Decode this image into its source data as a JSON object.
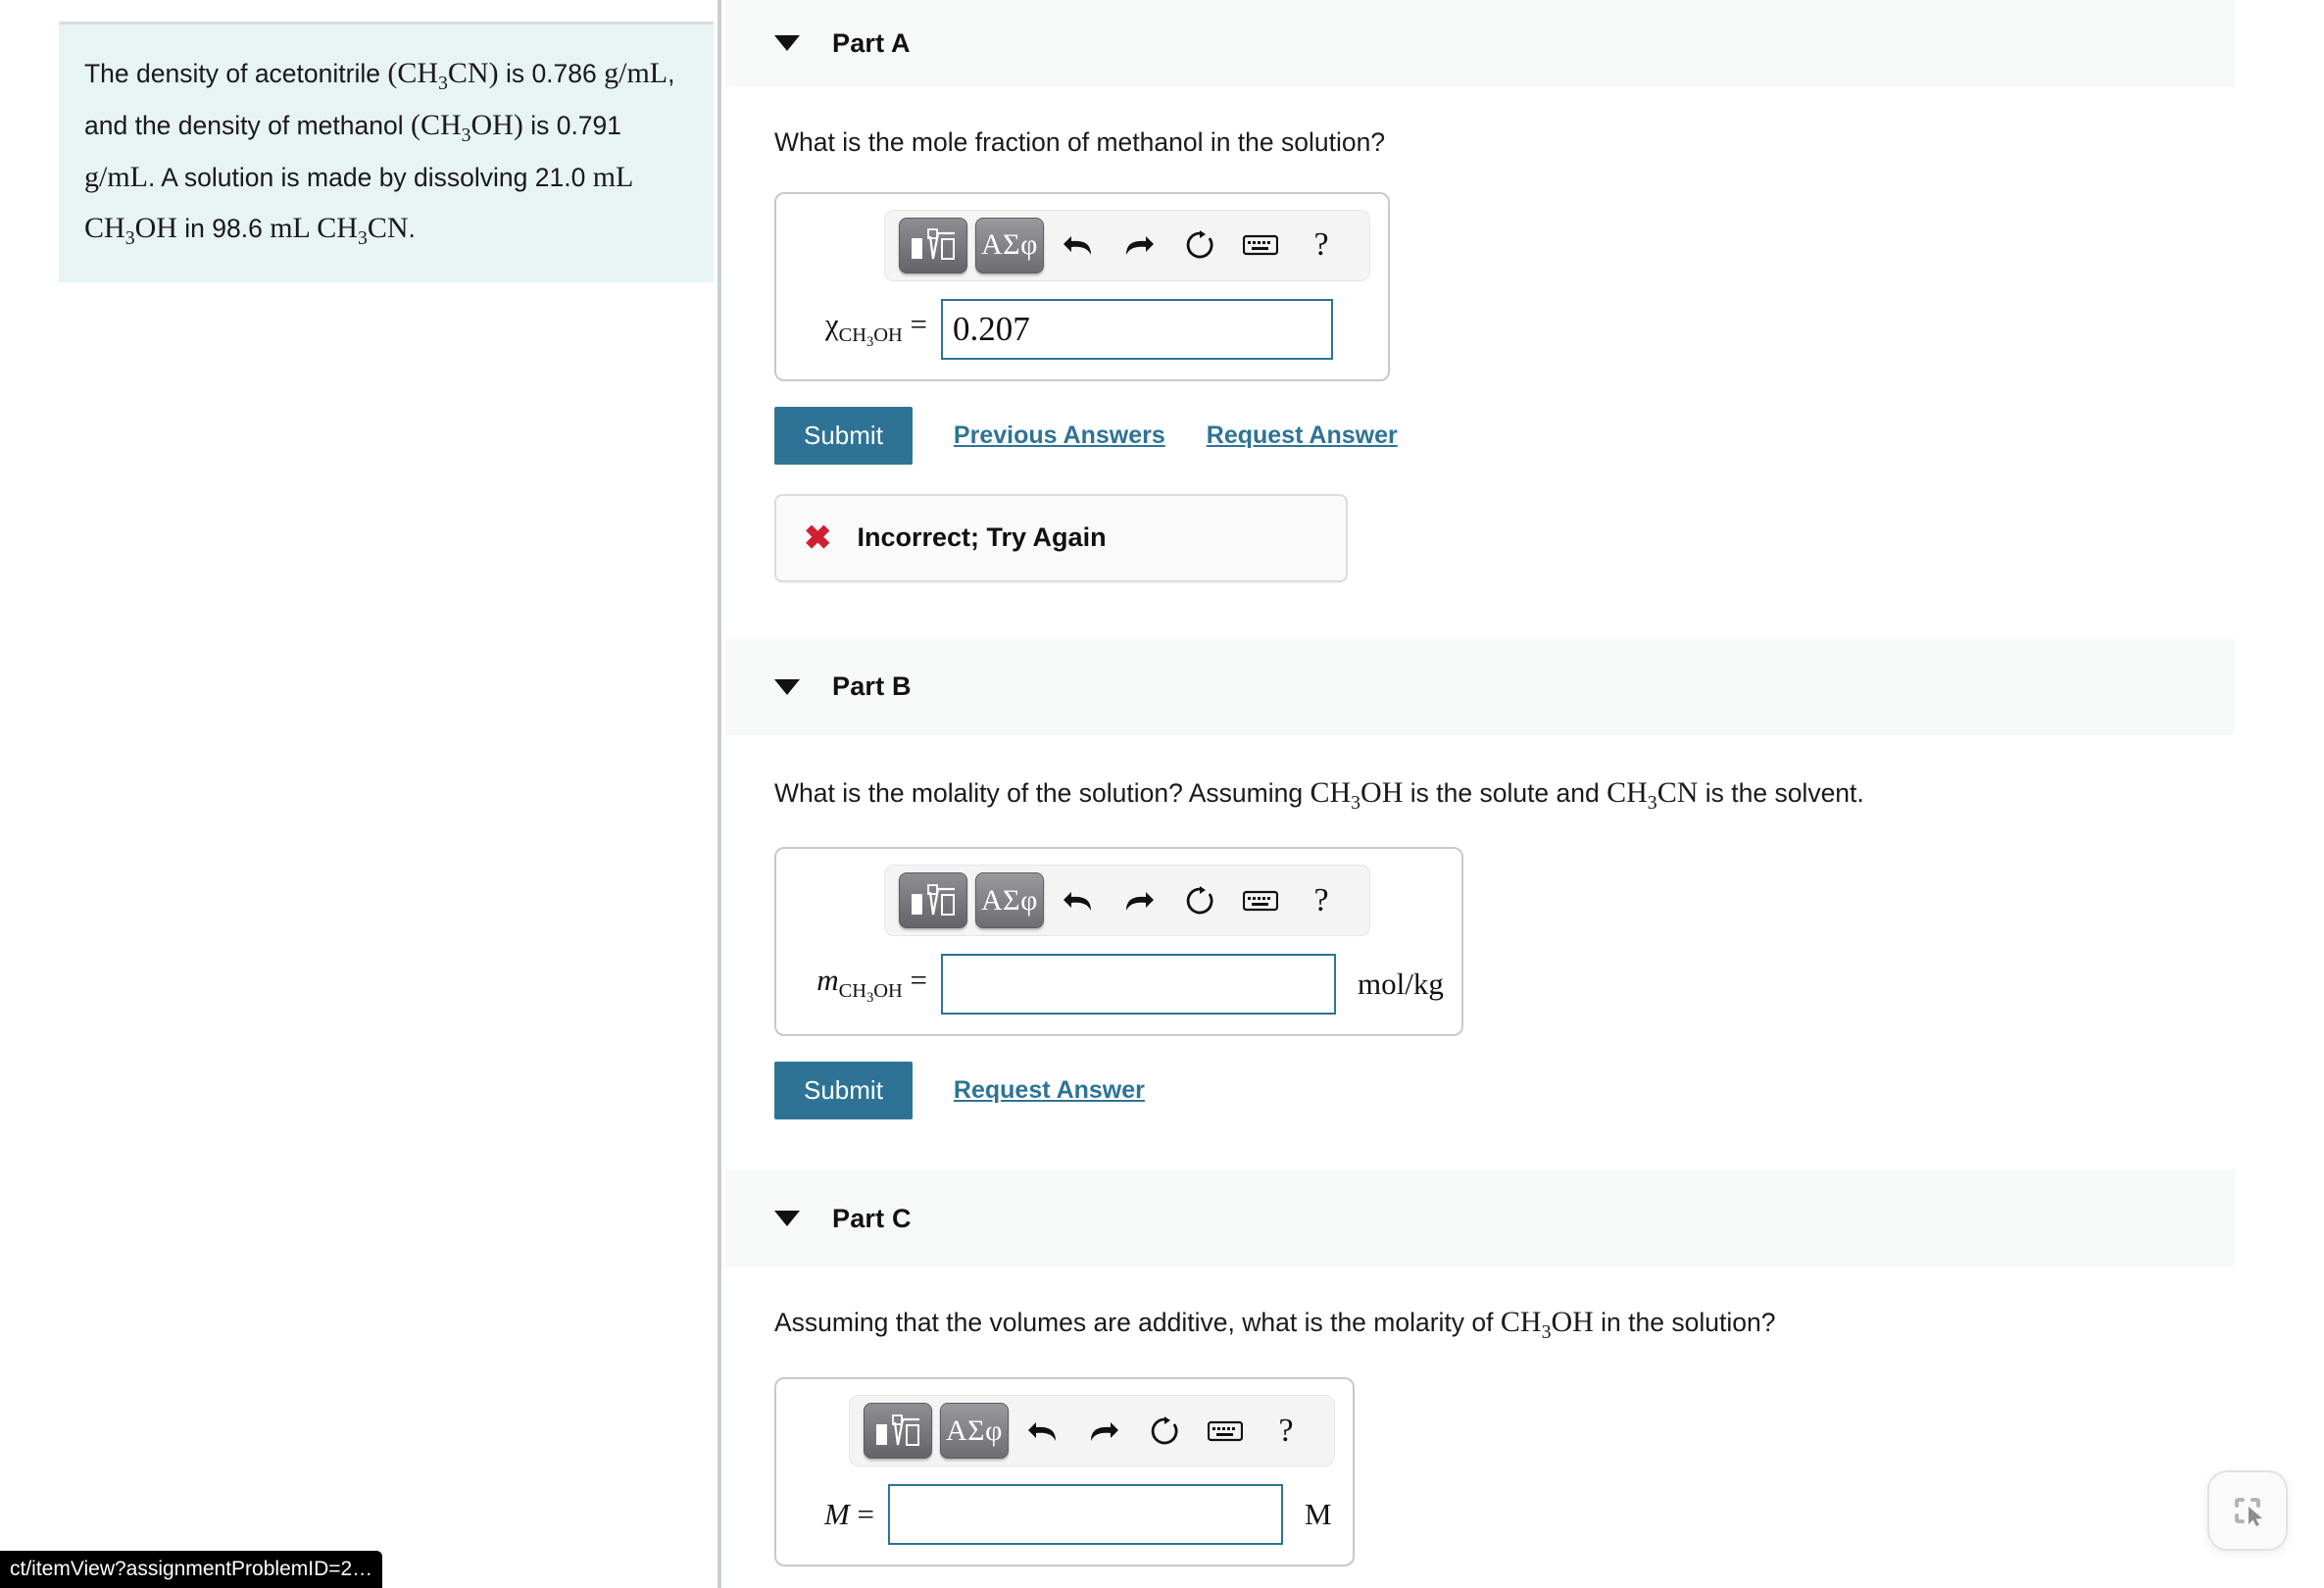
{
  "problem": {
    "text_parts": {
      "s1": "The density of acetonitrile ",
      "f1": "(CH3CN)",
      "s2": " is 0.786 ",
      "f2": "g/mL",
      "s3": ", and the density of methanol ",
      "f3": "(CH3OH)",
      "s4": " is 0.791 ",
      "f4": "g/mL",
      "s5": ". A solution is made by dissolving 21.0 ",
      "f5": "mL CH3OH",
      "s6": " in 98.6 ",
      "f6": "mL CH3CN",
      "s7": "."
    },
    "full_text": "The density of acetonitrile (CH3CN) is 0.786 g/mL, and the density of methanol (CH3OH) is 0.791 g/mL. A solution is made by dissolving 21.0 mL CH3OH in 98.6 mL CH3CN.",
    "background_color": "#e8f3f4"
  },
  "toolbar": {
    "math_template_label": "■√□",
    "greek_label": "ΑΣφ",
    "undo_name": "undo",
    "redo_name": "redo",
    "reset_name": "reset",
    "keyboard_name": "keyboard",
    "help_label": "?"
  },
  "parts": [
    {
      "id": "a",
      "title": "Part A",
      "question": "What is the mole fraction of methanol in the solution?",
      "variable": "χ",
      "variable_sub": "CH3OH",
      "variable_italic": false,
      "value": "0.207",
      "placeholder": "",
      "unit": "",
      "input_width": 400,
      "buttons": {
        "submit": "Submit",
        "previous_answers": "Previous Answers",
        "request_answer": "Request Answer"
      },
      "show_previous_answers": true,
      "feedback": {
        "visible": true,
        "icon": "x-mark",
        "text": "Incorrect; Try Again",
        "color": "#cf2031"
      }
    },
    {
      "id": "b",
      "title": "Part B",
      "question_pre": "What is the molality of the solution? Assuming ",
      "question_f1": "CH3OH",
      "question_mid": " is the solute and ",
      "question_f2": "CH3CN",
      "question_post": " is the solvent.",
      "question": "What is the molality of the solution? Assuming CH3OH is the solute and CH3CN is the solvent.",
      "variable": "m",
      "variable_sub": "CH3OH",
      "variable_italic": true,
      "value": "",
      "placeholder": "",
      "unit": "mol/kg",
      "input_width": 403,
      "buttons": {
        "submit": "Submit",
        "request_answer": "Request Answer"
      },
      "show_previous_answers": false,
      "feedback": {
        "visible": false,
        "icon": "",
        "text": "",
        "color": ""
      }
    },
    {
      "id": "c",
      "title": "Part C",
      "question_pre": "Assuming that the volumes are additive, what is the molarity of ",
      "question_f1": "CH3OH",
      "question_post": " in the solution?",
      "question": "Assuming that the volumes are additive, what is the molarity of CH3OH in the solution?",
      "variable": "M",
      "variable_sub": "",
      "variable_italic": true,
      "value": "",
      "placeholder": "",
      "unit": "M",
      "input_width": 403,
      "buttons": {},
      "show_previous_answers": false,
      "feedback": {
        "visible": false,
        "icon": "",
        "text": "",
        "color": ""
      }
    }
  ],
  "statusbar": {
    "url": "ct/itemView?assignmentProblemID=2…"
  },
  "floating_tool": {
    "name": "screenshot-select-tool"
  },
  "colors": {
    "accent": "#2e7396",
    "header_band": "#f7f8f8",
    "input_border": "#2e7396",
    "error": "#cf2031",
    "problem_bg": "#e8f3f4",
    "divider": "#c3cfdb"
  }
}
